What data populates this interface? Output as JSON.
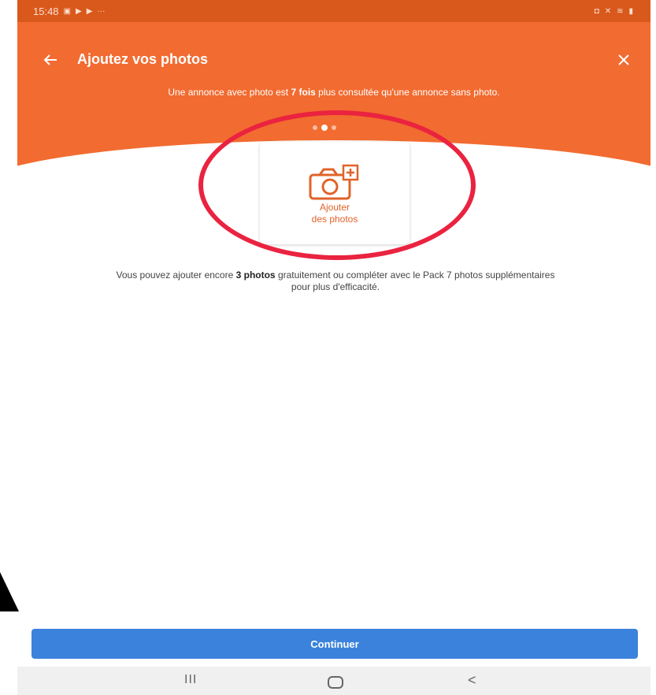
{
  "status_bar": {
    "time": "15:48",
    "notif_icons": [
      "image-icon",
      "play-icon",
      "play-icon"
    ],
    "more": "···"
  },
  "header": {
    "title": "Ajoutez vos photos",
    "subtitle_pre": "Une annonce avec photo est ",
    "subtitle_bold": "7 fois",
    "subtitle_post": " plus consultée qu'une annonce sans photo."
  },
  "carousel": {
    "dots": 3,
    "active_index": 1
  },
  "photo_card": {
    "line1": "Ajouter",
    "line2": "des photos",
    "icon": "camera-plus-icon"
  },
  "info": {
    "pre": "Vous pouvez ajouter encore ",
    "bold": "3 photos",
    "post": " gratuitement ou compléter avec le Pack 7 photos supplémentaires",
    "line2": "pour plus d'efficacité."
  },
  "continue_button": {
    "label": "Continuer"
  },
  "nav_bar": {
    "recents": "III",
    "back": "<"
  },
  "colors": {
    "header": "#f26b30",
    "status": "#d9591c",
    "accent": "#e0632a",
    "button": "#3b82dc",
    "ring": "#ea2340"
  }
}
